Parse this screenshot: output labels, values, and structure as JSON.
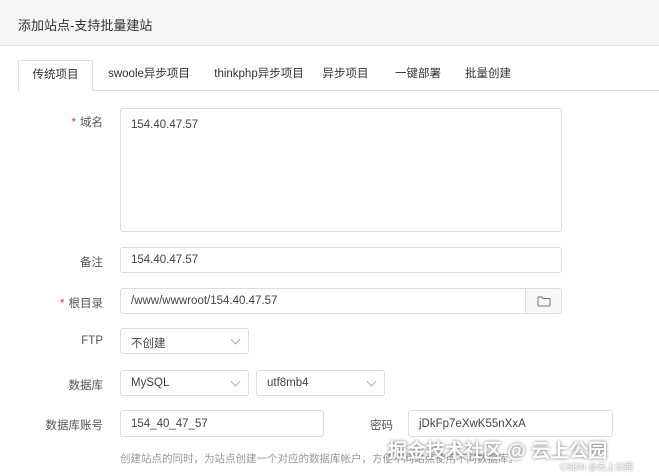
{
  "dialog": {
    "title": "添加站点-支持批量建站"
  },
  "tabs": [
    {
      "label": "传统项目",
      "active": true
    },
    {
      "label": "swoole异步项目"
    },
    {
      "label": "thinkphp异步项目"
    },
    {
      "label": "异步项目"
    },
    {
      "label": "一键部署"
    },
    {
      "label": "批量创建"
    }
  ],
  "form": {
    "domain": {
      "label": "域名",
      "required": true,
      "value": "154.40.47.57"
    },
    "remark": {
      "label": "备注",
      "value": "154.40.47.57"
    },
    "root": {
      "label": "根目录",
      "required": true,
      "value": "/www/wwwroot/154.40.47.57",
      "button_icon": "folder-icon"
    },
    "ftp": {
      "label": "FTP",
      "selected": "不创建"
    },
    "database": {
      "label": "数据库",
      "type_selected": "MySQL",
      "charset_selected": "utf8mb4"
    },
    "db_account": {
      "label": "数据库账号",
      "value": "154_40_47_57"
    },
    "db_password": {
      "label": "密码",
      "value": "jDkFp7eXwK55nXxA"
    },
    "hint": "创建站点的同时，为站点创建一个对应的数据库帐户，方便不同站点使用不同数据库。"
  },
  "watermark": {
    "main": "掘金技术社区 @ 云上公园",
    "sub": "CSDN @云上公园"
  },
  "colors": {
    "required": "#e23b3b",
    "border": "#dcdcdc"
  }
}
